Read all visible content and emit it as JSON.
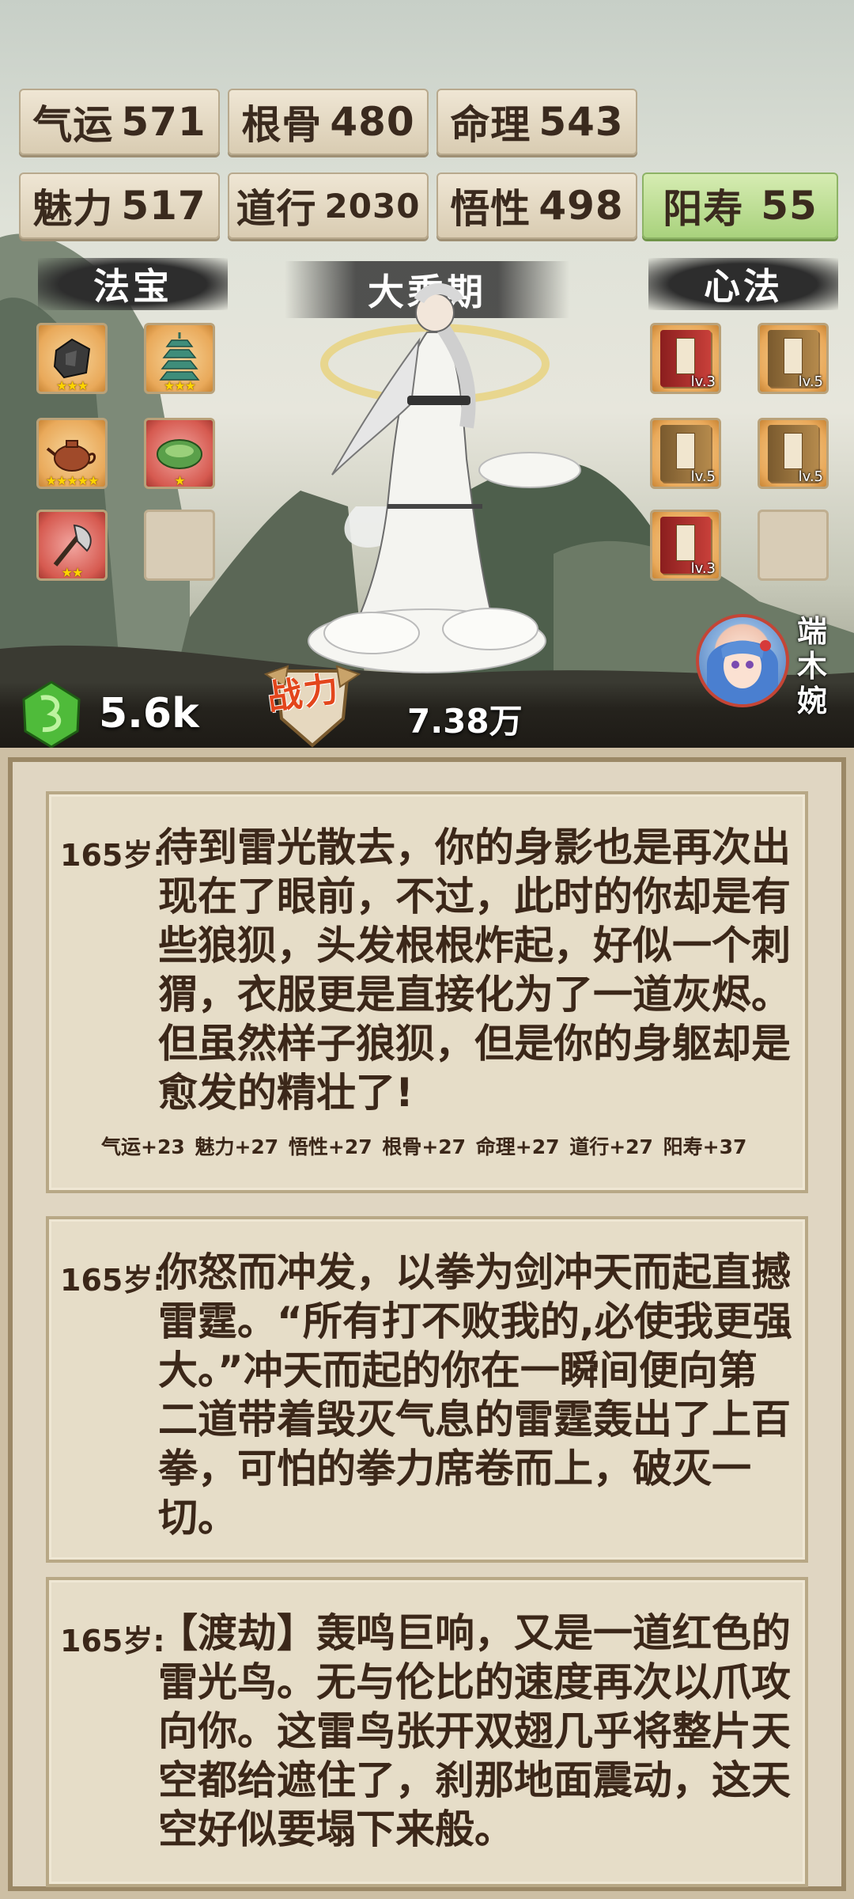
{
  "stats": {
    "row1": [
      {
        "label": "气运",
        "value": "571"
      },
      {
        "label": "根骨",
        "value": "480"
      },
      {
        "label": "命理",
        "value": "543"
      }
    ],
    "row2": [
      {
        "label": "魅力",
        "value": "517"
      },
      {
        "label": "道行",
        "value": "2030"
      },
      {
        "label": "悟性",
        "value": "498"
      },
      {
        "label": "阳寿",
        "value": "55"
      }
    ]
  },
  "sections": {
    "treasures": "法宝",
    "realm": "大乘期",
    "methods": "心法"
  },
  "treasures": [
    {
      "icon": "stone-icon",
      "rarity": "orange",
      "stars": "★★★"
    },
    {
      "icon": "pagoda-icon",
      "rarity": "orange",
      "stars": "★★★"
    },
    {
      "icon": "teapot-icon",
      "rarity": "orange",
      "stars": "★★★★★"
    },
    {
      "icon": "cauldron-icon",
      "rarity": "red",
      "stars": "★"
    },
    {
      "icon": "axe-icon",
      "rarity": "red",
      "stars": "★★"
    },
    {
      "icon": "empty-slot",
      "rarity": "empty",
      "stars": ""
    }
  ],
  "methods": [
    {
      "icon": "red-book-icon",
      "rarity": "orange",
      "level": "lv.3"
    },
    {
      "icon": "tan-book-icon",
      "rarity": "orange",
      "level": "lv.5"
    },
    {
      "icon": "tan-book-icon",
      "rarity": "orange",
      "level": "lv.5"
    },
    {
      "icon": "tan-book-icon",
      "rarity": "orange",
      "level": "lv.5"
    },
    {
      "icon": "red-book-icon",
      "rarity": "orange",
      "level": "lv.3"
    },
    {
      "icon": "empty-slot",
      "rarity": "empty",
      "level": ""
    }
  ],
  "bottom": {
    "gems": "5.6k",
    "power_label": "战力",
    "power_value": "7.38万"
  },
  "companion": {
    "name": "端木婉"
  },
  "logs": [
    {
      "age": "165岁:",
      "text": "待到雷光散去，你的身影也是再次出现在了眼前，不过，此时的你却是有些狼狈，头发根根炸起，好似一个刺猬，衣服更是直接化为了一道灰烬。但虽然样子狼狈，但是你的身躯却是愈发的精壮了!",
      "bonus": "气运+23  魅力+27  悟性+27  根骨+27  命理+27  道行+27  阳寿+37"
    },
    {
      "age": "165岁:",
      "text": "你怒而冲发，以拳为剑冲天而起直撼雷霆。“所有打不败我的,必使我更强大。”冲天而起的你在一瞬间便向第二道带着毁灭气息的雷霆轰出了上百拳，可怕的拳力席卷而上，破灭一切。",
      "bonus": ""
    },
    {
      "age": "165岁:",
      "text": "【渡劫】轰鸣巨响，又是一道红色的雷光鸟。无与伦比的速度再次以爪攻向你。这雷鸟张开双翅几乎将整片天空都给遮住了，刹那地面震动，这天空好似要塌下来般。",
      "bonus": ""
    }
  ]
}
